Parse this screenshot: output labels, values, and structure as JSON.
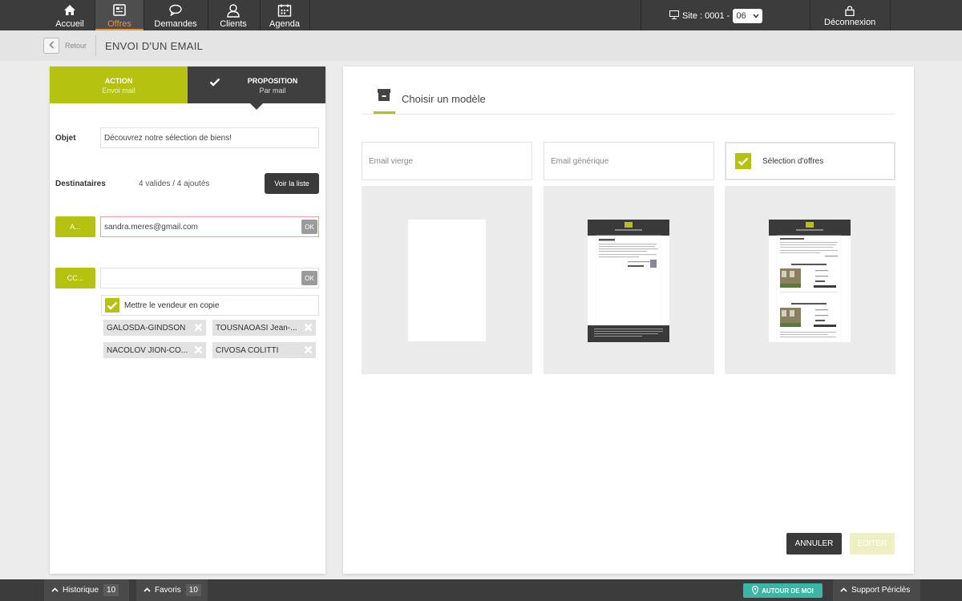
{
  "nav": {
    "items": [
      {
        "label": "Accueil",
        "icon": "home-icon"
      },
      {
        "label": "Offres",
        "icon": "offers-icon"
      },
      {
        "label": "Demandes",
        "icon": "chat-icon"
      },
      {
        "label": "Clients",
        "icon": "user-icon"
      },
      {
        "label": "Agenda",
        "icon": "calendar-icon"
      }
    ],
    "site_label": "Site : 0001 -",
    "site_value": "06",
    "logout_label": "Déconnexion"
  },
  "subheader": {
    "back_label": "Retour",
    "title": "ENVOI D'UN EMAIL"
  },
  "steps": [
    {
      "title": "ACTION",
      "subtitle": "Envoi mail"
    },
    {
      "title": "PROPOSITION",
      "subtitle": "Par mail"
    }
  ],
  "form": {
    "subject_label": "Objet",
    "subject_value": "Découvrez notre sélection de biens!",
    "recipients_label": "Destinataires",
    "recipients_count": "4 valides / 4 ajoutés",
    "view_list_label": "Voir la liste",
    "to_label": "A...",
    "to_value": "sandra.meres@gmail.com",
    "cc_label": "CC...",
    "cc_value": "",
    "ok_label": "OK",
    "copy_seller_label": "Mettre le vendeur en copie",
    "chips": [
      "GALOSDA-GINDSON",
      "TOUSNAOASI Jean-...",
      "NACOLOV JION-CO...",
      "CIVOSA COLITTI"
    ]
  },
  "templates": {
    "heading": "Choisir un modèle",
    "items": [
      {
        "label": "Email vierge",
        "selected": false
      },
      {
        "label": "Email générique",
        "selected": false
      },
      {
        "label": "Sélection d'offres",
        "selected": true
      }
    ]
  },
  "actions": {
    "cancel_label": "ANNULER",
    "edit_label": "EDITER"
  },
  "bottombar": {
    "history_label": "Historique",
    "history_count": "10",
    "favorites_label": "Favoris",
    "favorites_count": "10",
    "around_label": "AUTOUR DE MOI",
    "support_label": "Support Périclès"
  },
  "colors": {
    "accent": "#b5c20f",
    "dark": "#3c3c3c",
    "active_nav": "#e9942b",
    "teal": "#3bb6a5"
  }
}
